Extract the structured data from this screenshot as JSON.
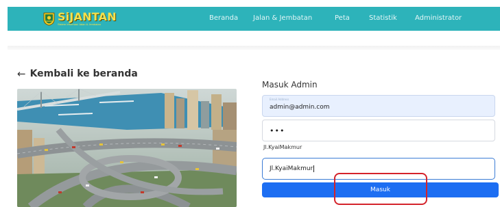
{
  "app": {
    "logo_title": "SiJANTAN",
    "logo_subtitle": "Sistem Informasi Jalan & Jembatan"
  },
  "nav": {
    "items": [
      {
        "label": "Beranda"
      },
      {
        "label": "Jalan & Jembatan"
      },
      {
        "label": "Peta"
      },
      {
        "label": "Statistik"
      },
      {
        "label": "Administrator"
      }
    ]
  },
  "back": {
    "arrow": "←",
    "label": "Kembali ke beranda"
  },
  "login": {
    "title": "Masuk Admin",
    "email_tiny_label": "Email Address",
    "email_value": "admin@admin.com",
    "password_value": "•••",
    "address_label": "Jl.KyaiMakmur",
    "address_value": "Jl.KyaiMakmur",
    "submit_label": "Masuk"
  },
  "colors": {
    "navbar": "#2db3ba",
    "logo": "#f3e04c",
    "primary_button": "#1d6ef2",
    "highlight": "#d4222a",
    "autofill_bg": "#e8f0fe"
  },
  "icons": {
    "logo": "regional-emblem-icon",
    "back": "arrow-left-icon"
  }
}
